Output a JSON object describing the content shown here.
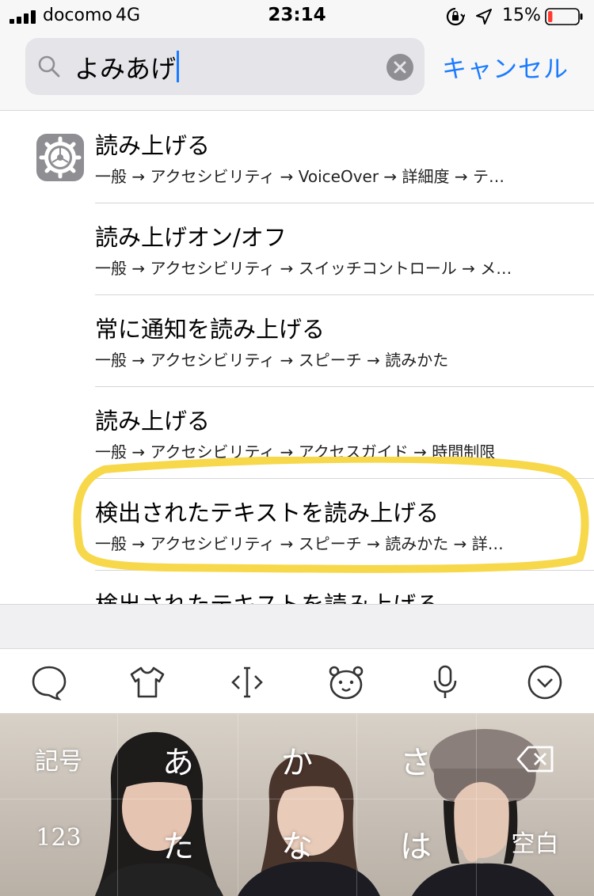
{
  "status_bar": {
    "carrier": "docomo",
    "network": "4G",
    "time": "23:14",
    "battery_percent": "15%",
    "battery_level": 0.15,
    "icons": [
      "signal-icon",
      "rotation-lock-icon",
      "location-icon",
      "battery-icon"
    ]
  },
  "search": {
    "query": "よみあげ",
    "cancel_label": "キャンセル",
    "icons": [
      "search-icon",
      "clear-icon"
    ]
  },
  "results": [
    {
      "title": "読み上げる",
      "path": "一般 → アクセシビリティ → VoiceOver → 詳細度 → テ…"
    },
    {
      "title": "読み上げオン/オフ",
      "path": "一般 → アクセシビリティ → スイッチコントロール → メ…"
    },
    {
      "title": "常に通知を読み上げる",
      "path": "一般 → アクセシビリティ → スピーチ → 読みかた"
    },
    {
      "title": "読み上げる",
      "path": "一般 → アクセシビリティ → アクセスガイド → 時間制限"
    },
    {
      "title": "検出されたテキストを読み上げる",
      "path": "一般 → アクセシビリティ → スピーチ → 読みかた → 詳…"
    },
    {
      "title": "検出されたテキストを読み上げる",
      "path": ""
    }
  ],
  "highlight_color": "#f7d84a",
  "accent_color": "#1a7bff",
  "keyboard_toolbar": {
    "icons": [
      "chat-bubble-icon",
      "shirt-icon",
      "cursor-move-icon",
      "bear-face-icon",
      "microphone-icon",
      "collapse-keyboard-icon"
    ]
  },
  "keyboard": {
    "row1": [
      "記号",
      "あ",
      "か",
      "さ"
    ],
    "row2": [
      "123",
      "た",
      "な",
      "は",
      "空白"
    ],
    "delete_icon": "backspace-icon"
  }
}
